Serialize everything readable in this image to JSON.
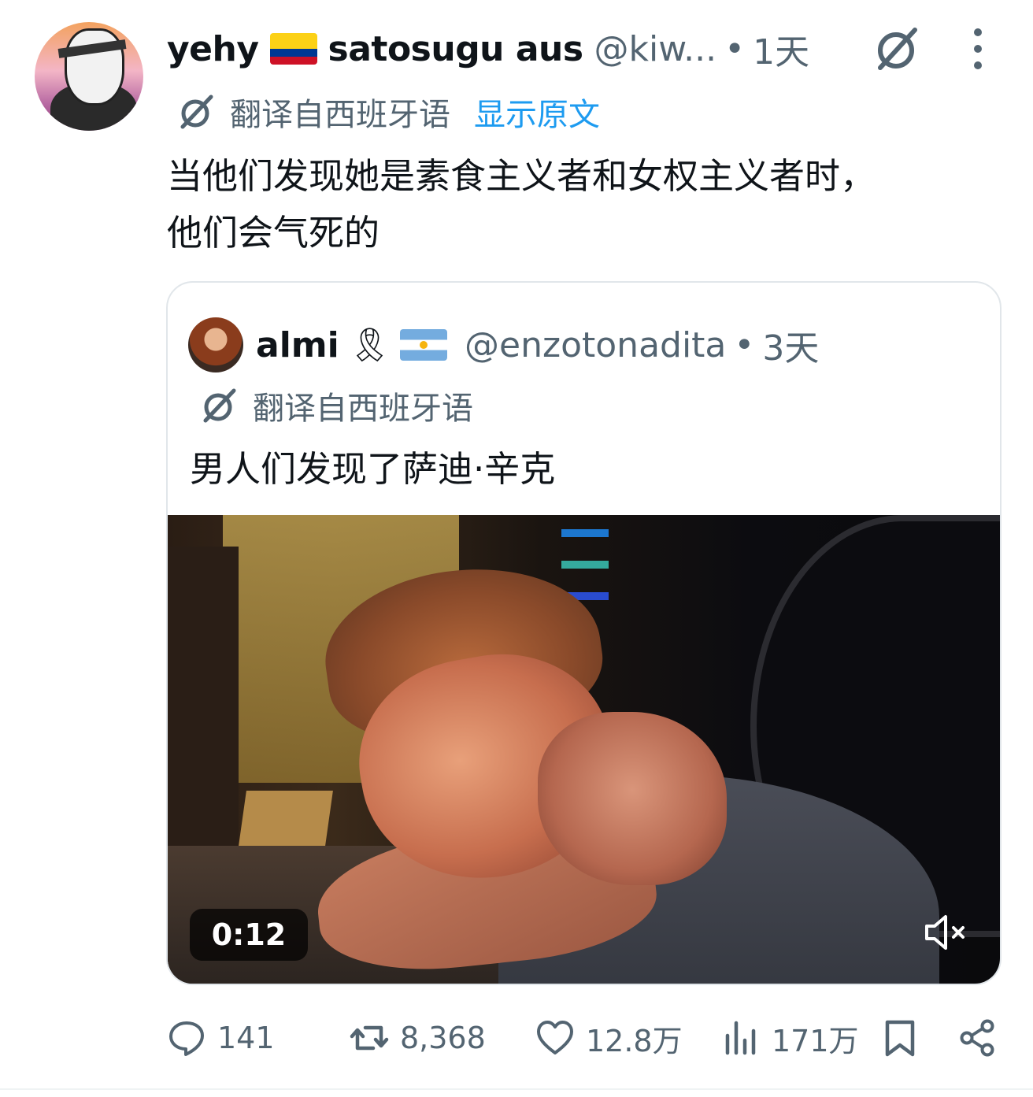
{
  "tweet": {
    "author": {
      "display_name": "yehy",
      "display_name_suffix": "satosugu aus",
      "flag_icon": "colombia-flag-icon",
      "handle": "@kiw...",
      "time": "1天"
    },
    "translate_label": "翻译自西班牙语",
    "show_original_label": "显示原文",
    "text_line1": "当他们发现她是素食主义者和女权主义者时，",
    "text_line2": "他们会气死的"
  },
  "quote": {
    "author": {
      "display_name": "almi",
      "ribbon": "🎗",
      "flag_icon": "argentina-flag-icon",
      "handle": "@enzotonadita",
      "time": "3天"
    },
    "translate_label": "翻译自西班牙语",
    "text": "男人们发现了萨迪·辛克",
    "video": {
      "duration": "0:12",
      "muted": true
    }
  },
  "actions": {
    "replies": "141",
    "reposts": "8,368",
    "likes": "12.8万",
    "views": "171万"
  },
  "colors": {
    "accent": "#1d9bf0",
    "secondary_text": "#536471",
    "primary_text": "#0f1419",
    "border": "#e1e6ea"
  }
}
